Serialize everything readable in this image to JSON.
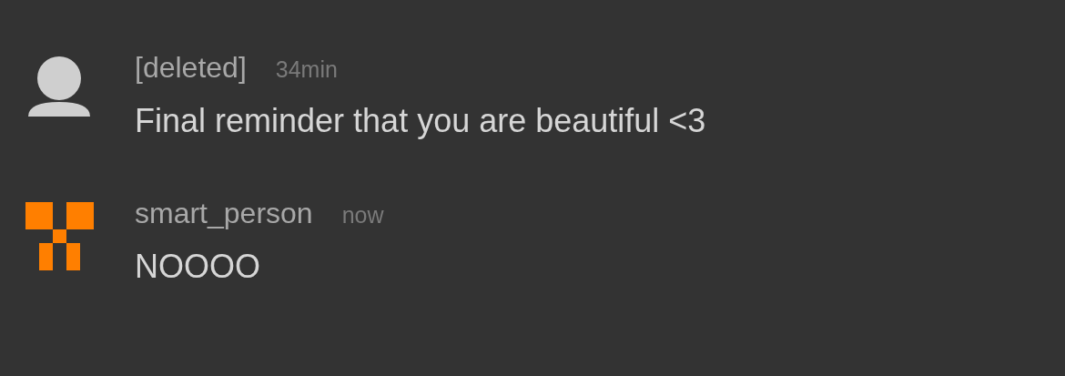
{
  "comments": [
    {
      "avatar": {
        "kind": "silhouette"
      },
      "author": "[deleted]",
      "time": "34min",
      "message": "Final reminder that you are beautiful <3"
    },
    {
      "avatar": {
        "kind": "identicon"
      },
      "author": "smart_person",
      "time": "now",
      "message": "NOOOO"
    }
  ]
}
